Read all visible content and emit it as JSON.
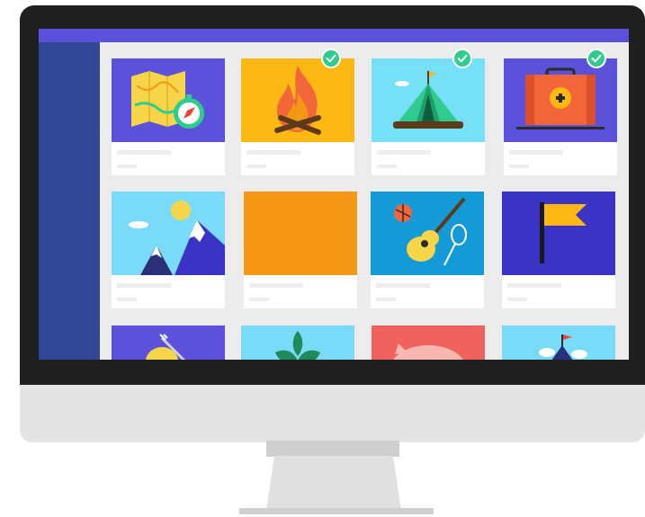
{
  "colors": {
    "topbar": "#5b51db",
    "sidebar": "#2f4795",
    "screen_bg": "#ececec",
    "check": "#2fcb8f"
  },
  "cards": [
    {
      "icon": "map-compass-icon",
      "bg": "#5b51db",
      "checked": false
    },
    {
      "icon": "campfire-icon",
      "bg": "#fdb813",
      "checked": true
    },
    {
      "icon": "tent-icon",
      "bg": "#76e0f7",
      "checked": true
    },
    {
      "icon": "first-aid-kit-icon",
      "bg": "#5b51db",
      "checked": true
    },
    {
      "icon": "mountains-icon",
      "bg": "#79dbf8",
      "checked": false
    },
    {
      "icon": "blank-thumbnail",
      "bg": "#f39714",
      "checked": false
    },
    {
      "icon": "guitar-sports-icon",
      "bg": "#159ad8",
      "checked": false
    },
    {
      "icon": "flag-icon",
      "bg": "#3b32c6",
      "checked": false
    },
    {
      "icon": "food-bowl-icon",
      "bg": "#5b51db",
      "checked": false
    },
    {
      "icon": "plant-icon",
      "bg": "#79dbf8",
      "checked": false
    },
    {
      "icon": "piggy-bank-icon",
      "bg": "#f0625e",
      "checked": false
    },
    {
      "icon": "summit-flag-icon",
      "bg": "#79dbf8",
      "checked": false
    }
  ]
}
